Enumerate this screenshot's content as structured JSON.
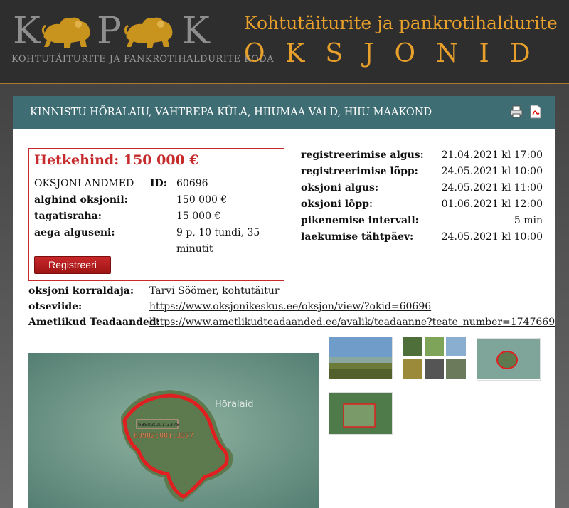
{
  "header": {
    "logo_sub": "KOHTUTÄITURITE JA PANKROTIHALDURITE KODA",
    "logo_letters": [
      "K",
      "P",
      "K"
    ],
    "title": "Kohtutäiturite ja pankrotihaldurite",
    "subtitle": "OKSJONID",
    "accent_color": "#e8a02c"
  },
  "listing": {
    "title": "KINNISTU HÕRALAIU, VAHTREPA KÜLA, HIIUMAA VALD, HIIU MAAKOND",
    "icons": [
      "printer-icon",
      "pdf-icon"
    ]
  },
  "price_box": {
    "current_price": "Hetkehind: 150 000 €",
    "section_label": "OKSJONI ANDMED",
    "id_label": "ID:",
    "id_value": "60696",
    "start_price_label": "alghind oksjonil:",
    "start_price_value": "150 000 €",
    "deposit_label": "tagatisraha:",
    "deposit_value": "15 000 €",
    "time_left_label": "aega alguseni:",
    "time_left_line1": "9 p, 10 tundi, 35",
    "time_left_line2": "minutit",
    "register_button": "Registreeri"
  },
  "dates": [
    {
      "label": "registreerimise algus:",
      "value": "21.04.2021 kl 17:00"
    },
    {
      "label": "registreerimise lõpp:",
      "value": "24.05.2021 kl 10:00"
    },
    {
      "label": "oksjoni algus:",
      "value": "24.05.2021 kl 11:00"
    },
    {
      "label": "oksjoni lõpp:",
      "value": "01.06.2021 kl 12:00"
    },
    {
      "label": "pikenemise intervall:",
      "value": "5 min"
    },
    {
      "label": "laekumise tähtpäev:",
      "value": "24.05.2021 kl 10:00"
    }
  ],
  "info": {
    "organizer_label": "oksjoni korraldaja:",
    "organizer_value": "Tarvi Söömer, kohtutäitur",
    "direct_link_label": "otseviide:",
    "direct_link_value": "https://www.oksjonikeskus.ee/oksjon/view/?okid=60696",
    "announcements_label": "Ametlikud Teadaanded:",
    "announcements_value": "https://www.ametlikudteadaanded.ee/avalik/teadaanne?teate_number=1747669"
  },
  "map": {
    "place_label": "Hõralaid",
    "parcel_small": "63902:001:3378",
    "parcel_main": "63902:001:3377"
  }
}
